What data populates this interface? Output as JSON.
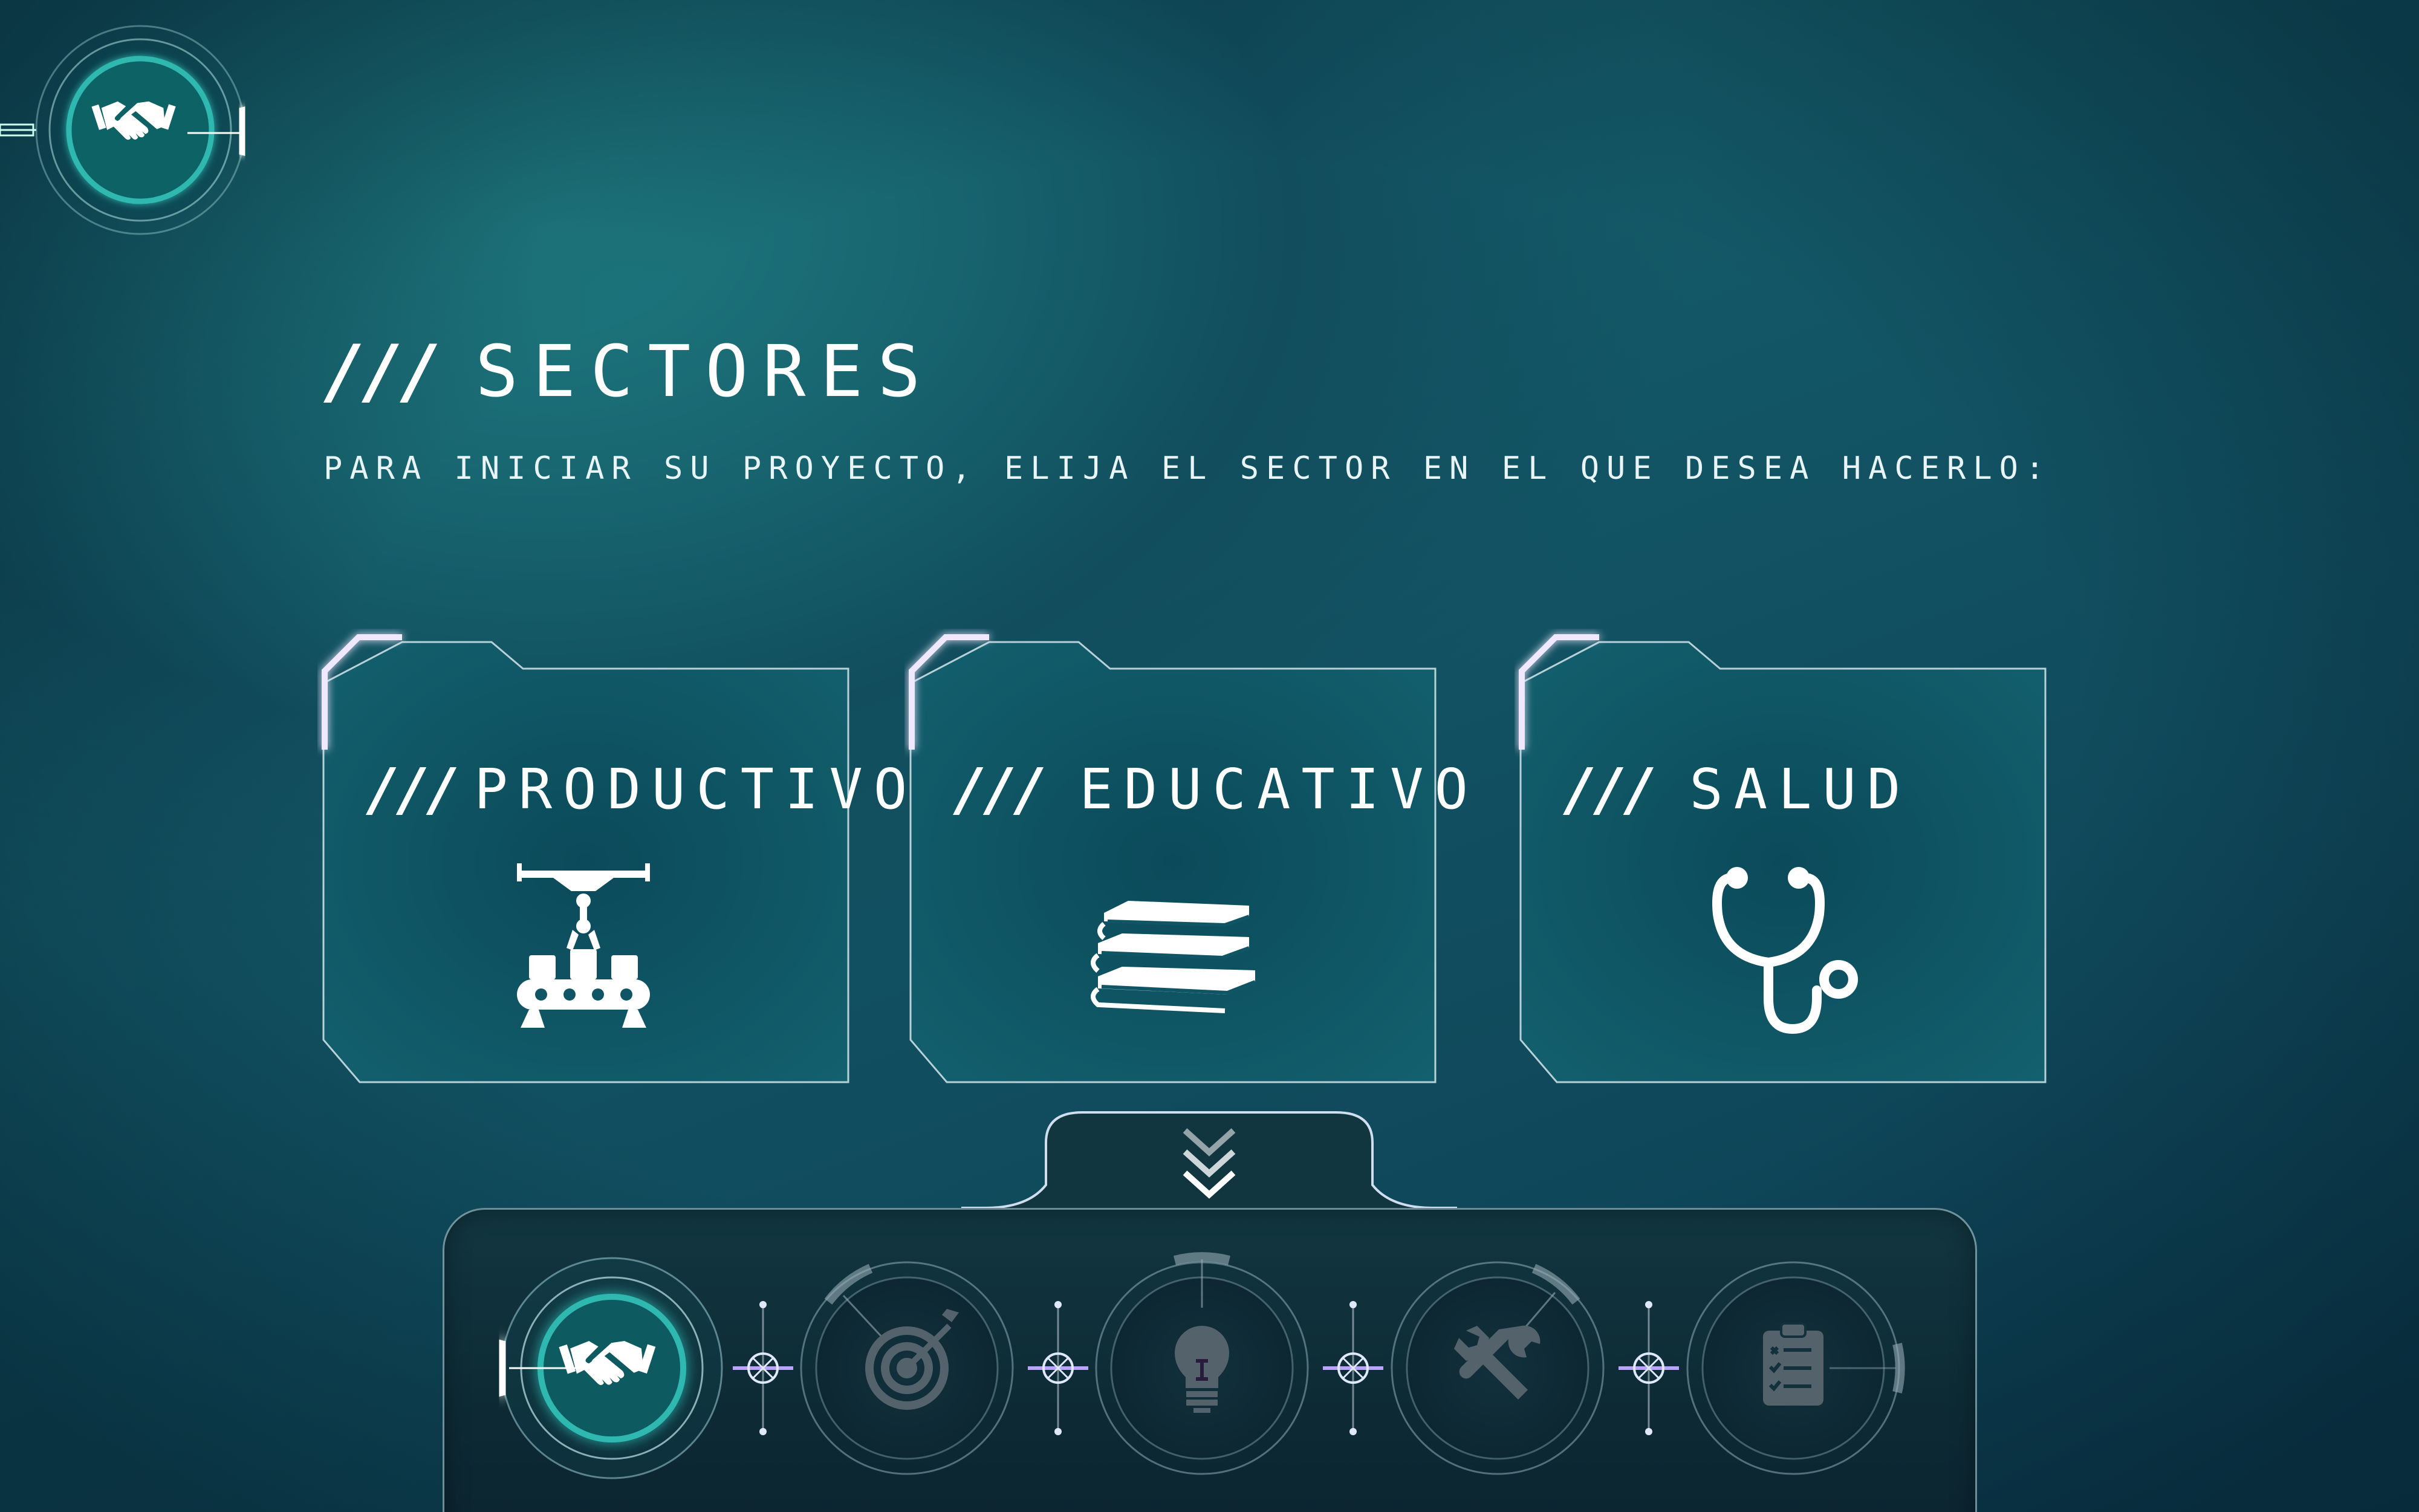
{
  "header": {
    "title": "SECTORES",
    "subtitle": "PARA INICIAR SU PROYECTO, ELIJA EL SECTOR EN EL QUE DESEA HACERLO:",
    "prefix": "///"
  },
  "logo": {
    "icon": "handshake-icon"
  },
  "sectors": [
    {
      "label": "PRODUCTIVO",
      "icon": "conveyor-robot-icon"
    },
    {
      "label": "EDUCATIVO",
      "icon": "books-icon"
    },
    {
      "label": "SALUD",
      "icon": "stethoscope-icon"
    }
  ],
  "steps": [
    {
      "icon": "handshake-icon",
      "state": "active"
    },
    {
      "icon": "target-icon",
      "state": "inactive"
    },
    {
      "icon": "lightbulb-icon",
      "state": "inactive"
    },
    {
      "icon": "tools-icon",
      "state": "inactive"
    },
    {
      "icon": "clipboard-checklist-icon",
      "state": "inactive"
    }
  ],
  "colors": {
    "background": "#17646f",
    "panel": "#0d2a34",
    "card_fill": "#0f5565",
    "accent_glow": "#e6dcff",
    "teal_ring": "#2fb8b0",
    "inactive_icon": "#54636b",
    "connector_purple": "#b9a4ff"
  }
}
